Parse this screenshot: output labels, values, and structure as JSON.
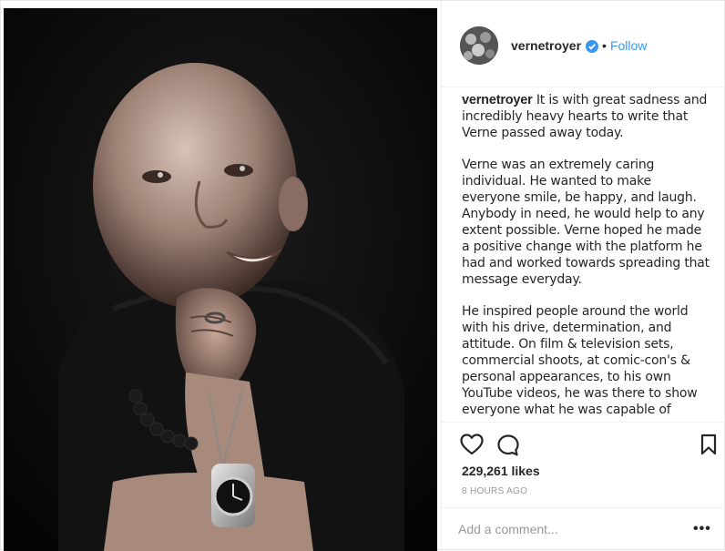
{
  "header": {
    "username": "vernetroyer",
    "follow_label": "Follow",
    "separator": "•"
  },
  "caption": {
    "username": "vernetroyer",
    "paragraphs": [
      "It is with great sadness and incredibly heavy hearts to write that Verne passed away today.",
      "Verne was an extremely caring individual. He wanted to make everyone smile, be happy, and laugh. Anybody in need, he would help to any extent possible. Verne hoped he made a positive change with the platform he had and worked towards spreading that message everyday.",
      "He inspired people around the world with his drive, determination, and attitude. On film & television sets, commercial shoots, at comic-con's & personal appearances, to his own YouTube videos, he was there to show everyone what he was capable of doing. Even though his stature was small and his parents often wondered if he'd be"
    ]
  },
  "stats": {
    "likes": "229,261 likes",
    "timestamp": "8 HOURS AGO"
  },
  "comment": {
    "placeholder": "Add a comment...",
    "more_label": "•••"
  },
  "colors": {
    "follow_blue": "#3897f0",
    "verified_blue": "#3897f0",
    "muted_gray": "#999999",
    "text": "#262626",
    "divider": "#efefef"
  },
  "icons": {
    "like": "heart-icon",
    "comment": "comment-bubble-icon",
    "save": "bookmark-icon",
    "verified": "verified-badge-icon"
  }
}
